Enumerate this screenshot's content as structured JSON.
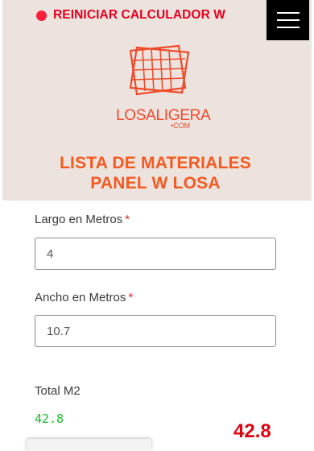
{
  "header": {
    "reset_label": "REINICIAR CALCULADOR W",
    "reset_dot_color": "#ff1f3d",
    "menu_icon": "hamburger-icon"
  },
  "brand": {
    "logo_icon": "panel-grid-logo",
    "name": "LOSALIGERA",
    "sub": "•COM",
    "color": "#f04a2a"
  },
  "title": {
    "line1": "LISTA DE MATERIALES",
    "line2": "PANEL W LOSA"
  },
  "form": {
    "largo": {
      "label": "Largo en Metros",
      "required_mark": "*",
      "value": "4"
    },
    "ancho": {
      "label": "Ancho en Metros",
      "required_mark": "*",
      "value": "10.7"
    }
  },
  "total": {
    "label": "Total M2",
    "value": "42.8",
    "value_big": "42.8"
  }
}
